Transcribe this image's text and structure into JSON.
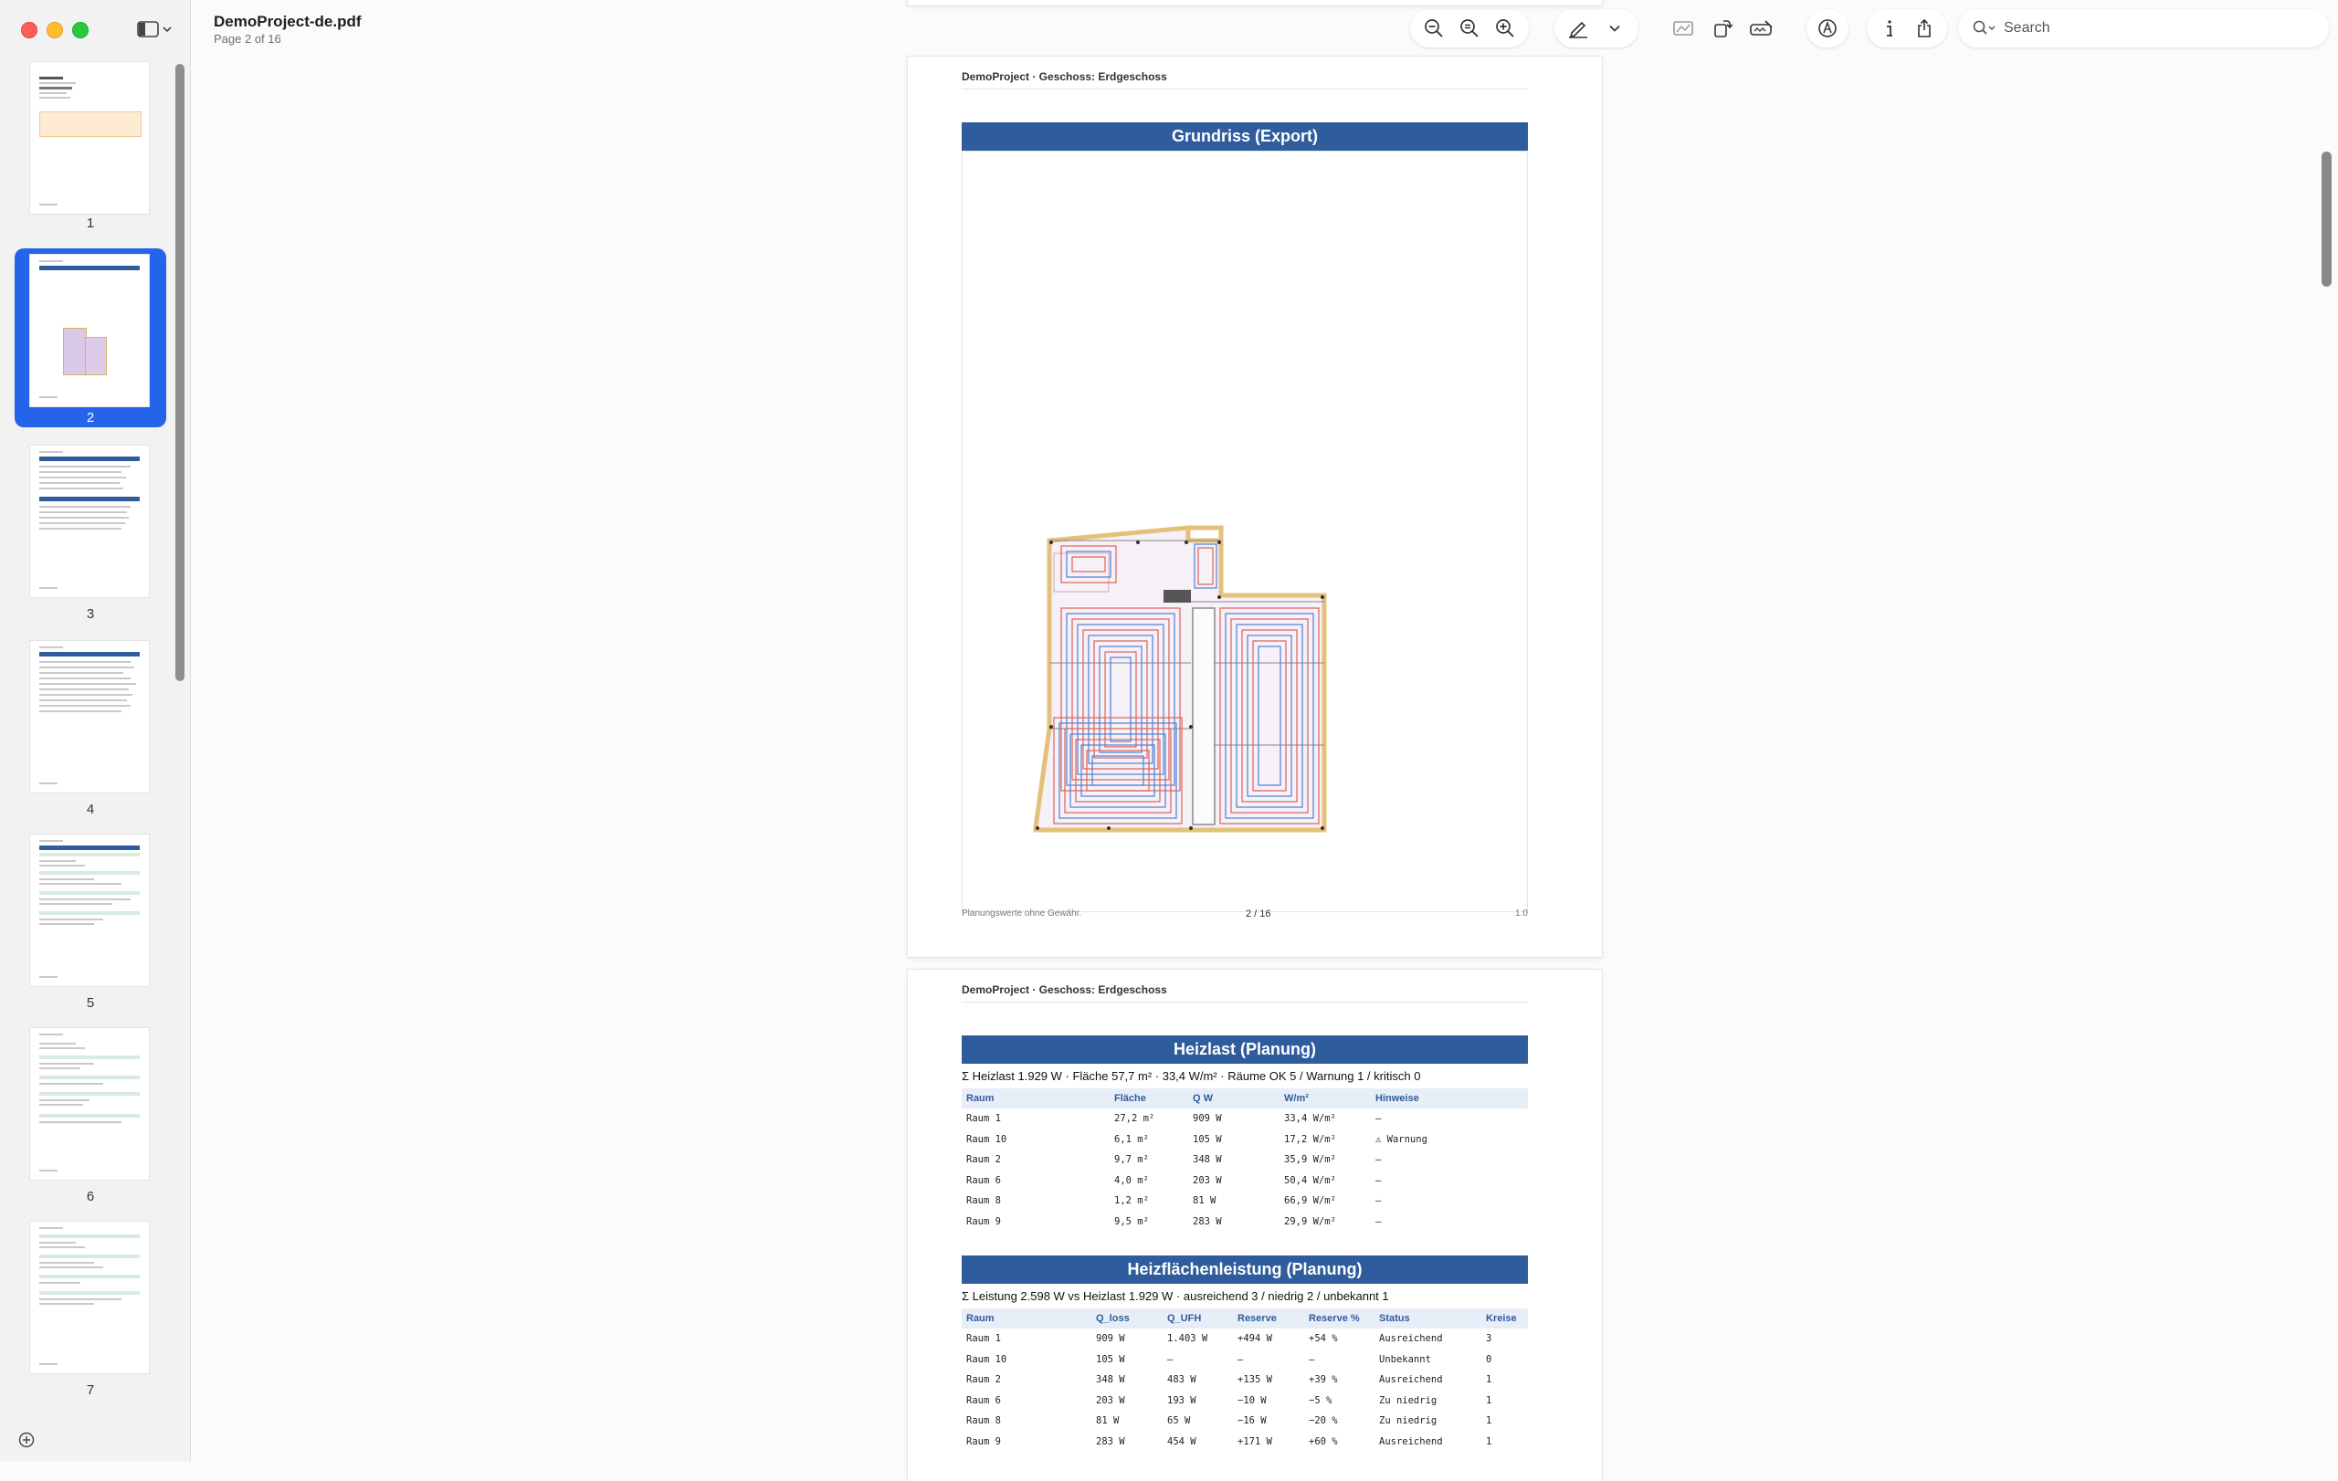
{
  "app": {
    "title": "DemoProject-de.pdf",
    "subtitle": "Page 2 of 16"
  },
  "toolbar": {
    "search_placeholder": "Search",
    "buttons": [
      "zoom-out-icon",
      "actual-size-icon",
      "zoom-in-icon",
      "highlight-pen-icon",
      "chevron-down-icon",
      "crop-icon",
      "rotate-icon",
      "annotate-icon",
      "markup-icon",
      "info-icon",
      "share-icon"
    ]
  },
  "sidebar": {
    "thumbnails": [
      {
        "label": "1"
      },
      {
        "label": "2",
        "selected": true
      },
      {
        "label": "3"
      },
      {
        "label": "4"
      },
      {
        "label": "5"
      },
      {
        "label": "6"
      },
      {
        "label": "7"
      }
    ]
  },
  "page2": {
    "header": "DemoProject  ·  Geschoss: Erdgeschoss",
    "section_title": "Grundriss (Export)",
    "footer_left": "Planungswerte ohne Gewähr.",
    "footer_center": "2 / 16",
    "footer_right": "1.0"
  },
  "page3": {
    "header": "DemoProject  ·  Geschoss: Erdgeschoss",
    "heizlast": {
      "title": "Heizlast (Planung)",
      "summary": "Σ Heizlast 1.929 W · Fläche 57,7 m² · 33,4 W/m² · Räume OK 5 / Warnung 1 / kritisch 0",
      "columns": [
        "Raum",
        "Fläche",
        "Q W",
        "W/m²",
        "Hinweise"
      ],
      "rows": [
        [
          "Raum 1",
          "27,2 m²",
          "909 W",
          "33,4 W/m²",
          "—"
        ],
        [
          "Raum 10",
          "6,1 m²",
          "105 W",
          "17,2 W/m²",
          "⚠ Warnung"
        ],
        [
          "Raum 2",
          "9,7 m²",
          "348 W",
          "35,9 W/m²",
          "—"
        ],
        [
          "Raum 6",
          "4,0 m²",
          "203 W",
          "50,4 W/m²",
          "—"
        ],
        [
          "Raum 8",
          "1,2 m²",
          "81 W",
          "66,9 W/m²",
          "—"
        ],
        [
          "Raum 9",
          "9,5 m²",
          "283 W",
          "29,9 W/m²",
          "—"
        ]
      ]
    },
    "heizflaeche": {
      "title": "Heizflächenleistung (Planung)",
      "summary": "Σ Leistung 2.598 W vs Heizlast 1.929 W · ausreichend 3 / niedrig 2 / unbekannt 1",
      "columns": [
        "Raum",
        "Q_loss",
        "Q_UFH",
        "Reserve",
        "Reserve %",
        "Status",
        "Kreise"
      ],
      "rows": [
        [
          "Raum 1",
          "909 W",
          "1.403 W",
          "+494 W",
          "+54 %",
          "Ausreichend",
          "3"
        ],
        [
          "Raum 10",
          "105 W",
          "—",
          "—",
          "—",
          "Unbekannt",
          "0"
        ],
        [
          "Raum 2",
          "348 W",
          "483 W",
          "+135 W",
          "+39 %",
          "Ausreichend",
          "1"
        ],
        [
          "Raum 6",
          "203 W",
          "193 W",
          "−10 W",
          "−5 %",
          "Zu niedrig",
          "1"
        ],
        [
          "Raum 8",
          "81 W",
          "65 W",
          "−16 W",
          "−20 %",
          "Zu niedrig",
          "1"
        ],
        [
          "Raum 9",
          "283 W",
          "454 W",
          "+171 W",
          "+60 %",
          "Ausreichend",
          "1"
        ]
      ]
    }
  },
  "colors": {
    "accent": "#2563eb",
    "section_bar": "#2f5c9c",
    "pipe_red": "#e0605a",
    "pipe_blue": "#4f7fd6"
  }
}
